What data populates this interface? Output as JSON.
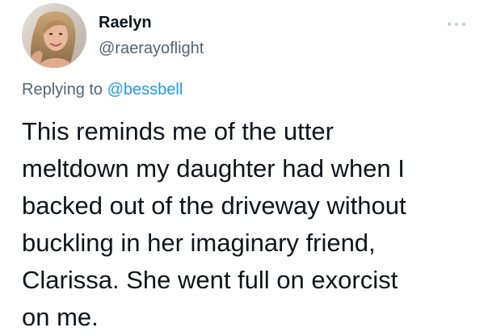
{
  "tweet": {
    "author": {
      "display_name": "Raelyn",
      "handle": "@raerayoflight",
      "avatar_icon": "user-avatar-photo"
    },
    "more_icon": "more-horizontal-icon",
    "reply_context": {
      "prefix": "Replying to",
      "mention": "@bessbell"
    },
    "text_lines": [
      "This reminds me of the utter",
      "meltdown my daughter had when I",
      "backed out of the driveway without",
      "buckling in her imaginary friend,",
      "Clarissa. She went full on exorcist",
      "on me."
    ],
    "colors": {
      "text": "#0f1419",
      "secondary": "#536471",
      "accent": "#1d9bf0"
    }
  }
}
